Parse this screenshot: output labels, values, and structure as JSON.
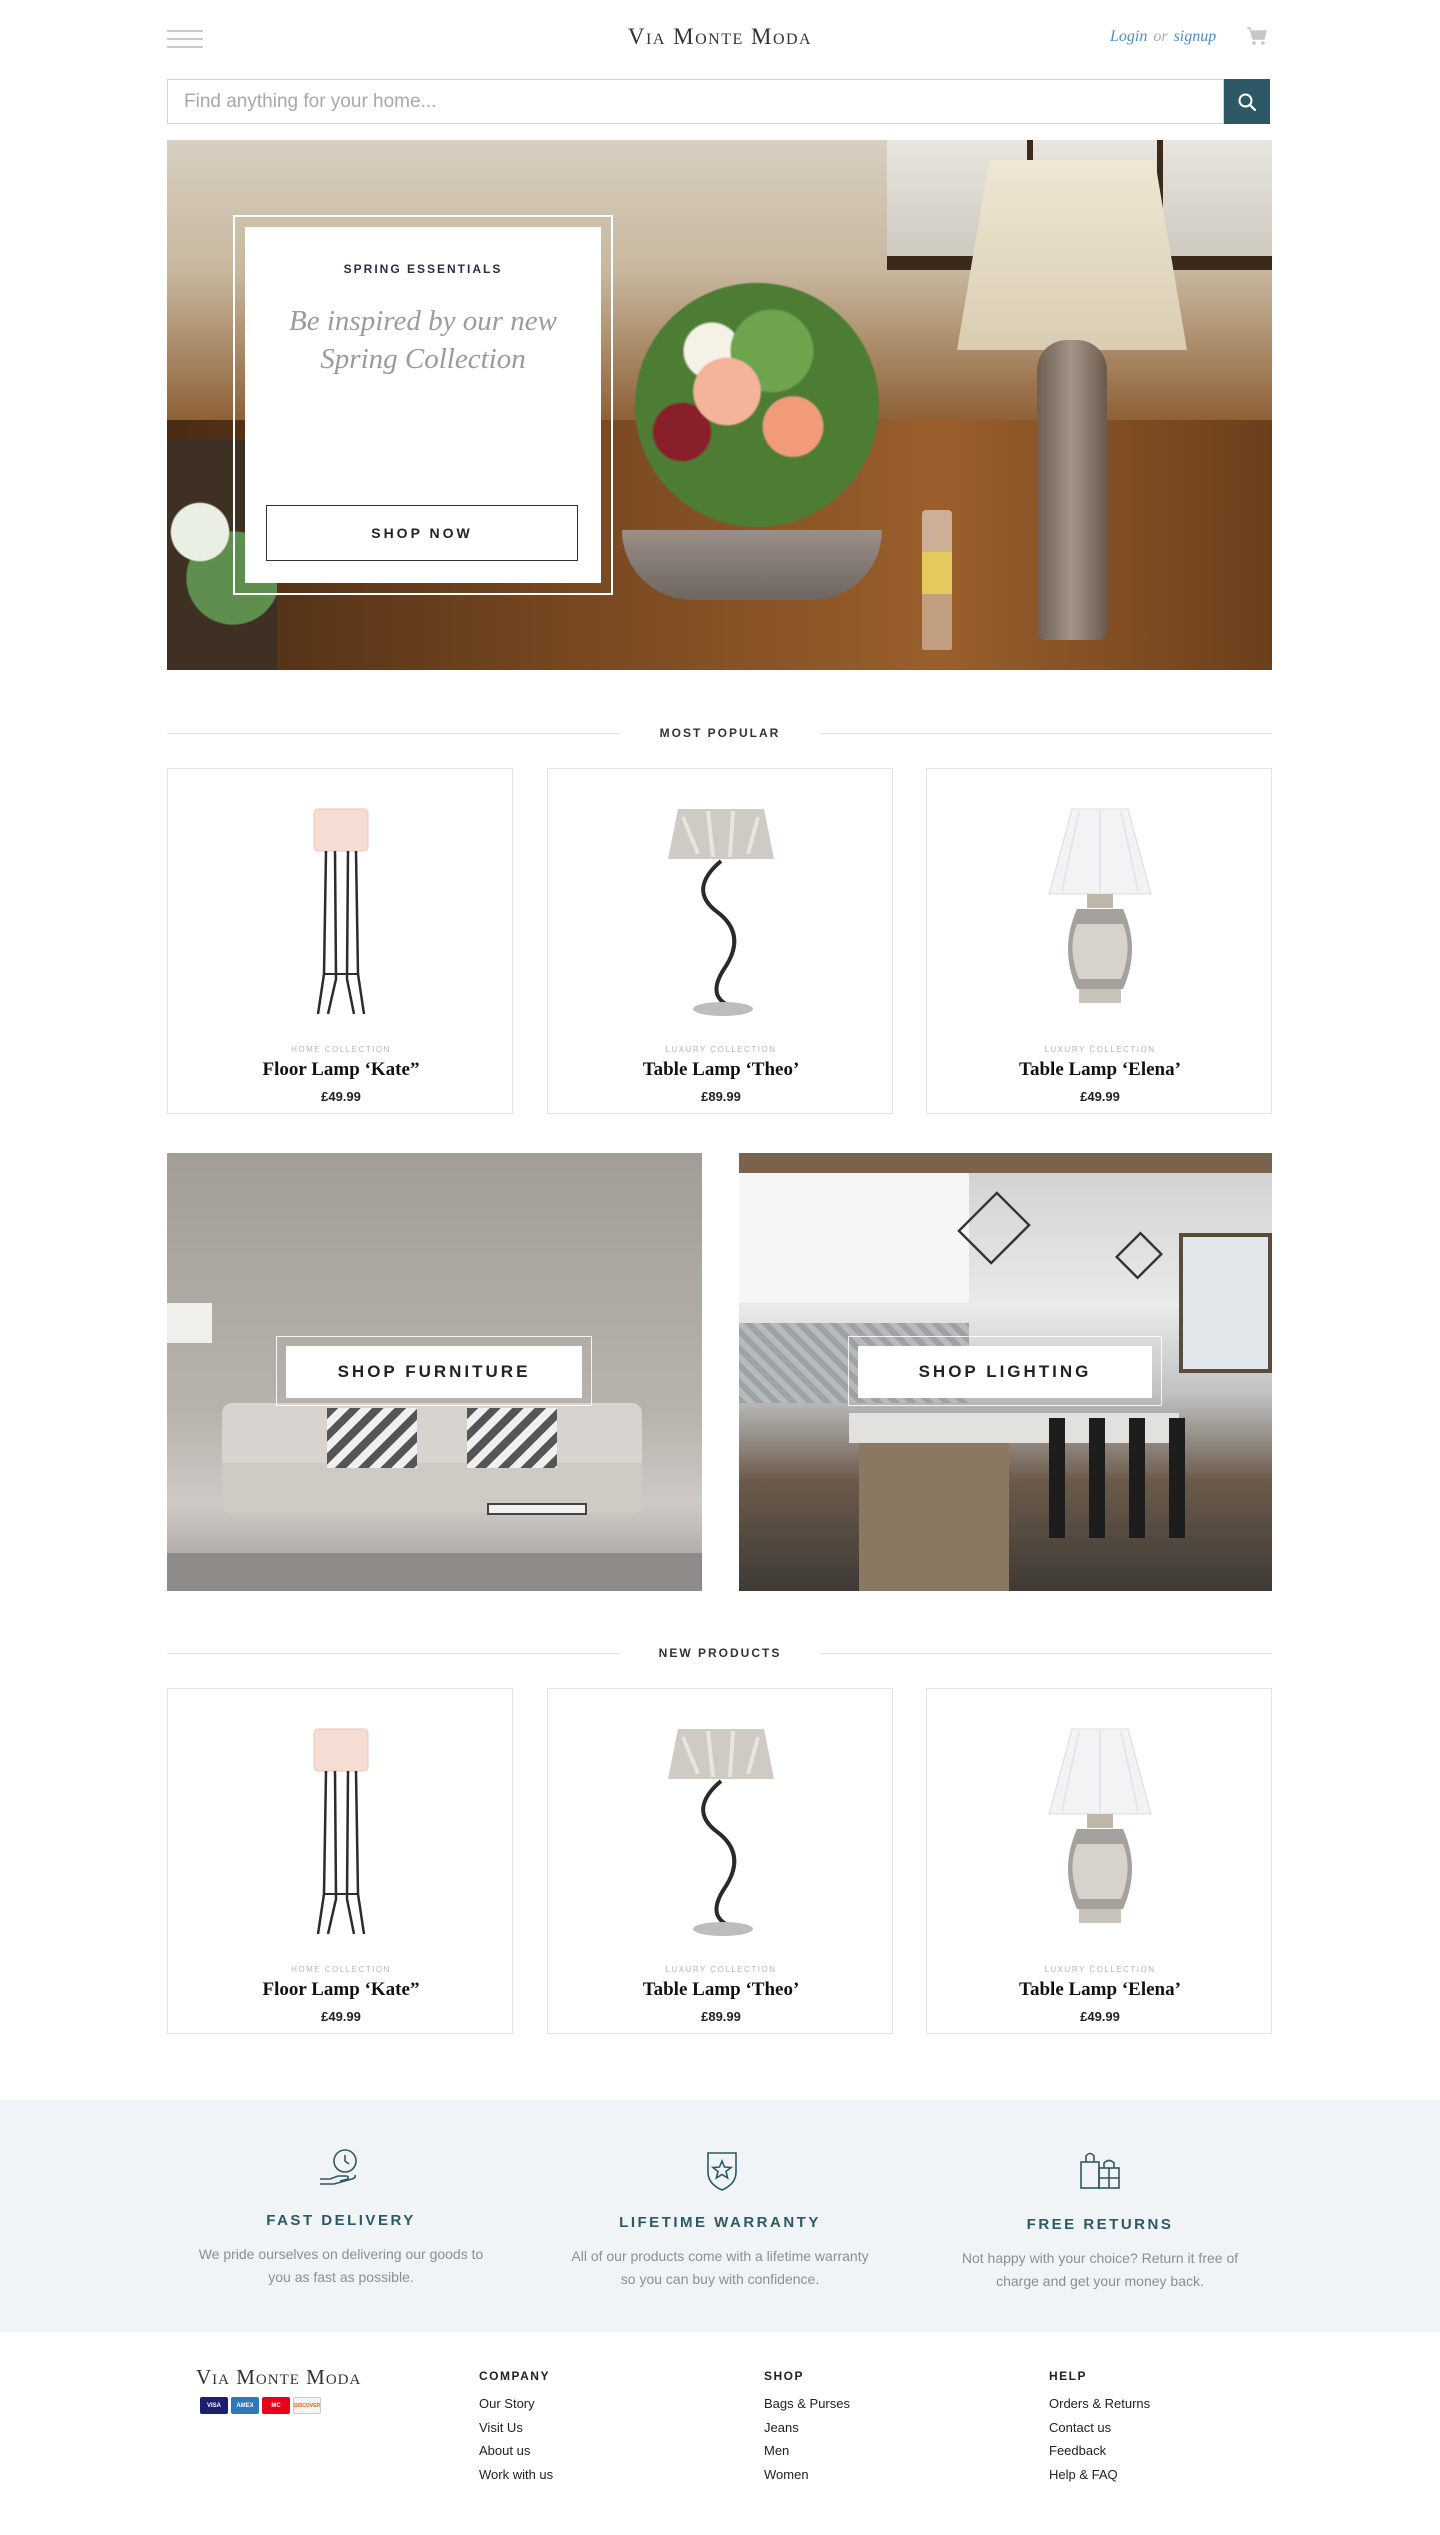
{
  "header": {
    "brand": "Via Monte Moda",
    "login": "Login",
    "or": "or",
    "signup": "signup"
  },
  "search": {
    "placeholder": "Find anything for your home..."
  },
  "hero": {
    "eyebrow": "SPRING ESSENTIALS",
    "headline": "Be inspired by our new Spring Collection",
    "cta": "SHOP NOW"
  },
  "most_popular": {
    "title": "MOST POPULAR",
    "products": [
      {
        "collection": "HOME COLLECTION",
        "name": "Floor Lamp ‘Kate”",
        "price": "£49.99",
        "image": "floor-lamp"
      },
      {
        "collection": "LUXURY COLLECTION",
        "name": "Table Lamp ‘Theo’",
        "price": "£89.99",
        "image": "table-lamp-theo"
      },
      {
        "collection": "LUXURY COLLECTION",
        "name": "Table Lamp ‘Elena’",
        "price": "£49.99",
        "image": "table-lamp-elena"
      }
    ]
  },
  "categories": {
    "furniture": "SHOP FURNITURE",
    "lighting": "SHOP LIGHTING"
  },
  "new_products": {
    "title": "NEW PRODUCTS",
    "products": [
      {
        "collection": "HOME COLLECTION",
        "name": "Floor Lamp ‘Kate”",
        "price": "£49.99",
        "image": "floor-lamp"
      },
      {
        "collection": "LUXURY COLLECTION",
        "name": "Table Lamp ‘Theo’",
        "price": "£89.99",
        "image": "table-lamp-theo"
      },
      {
        "collection": "LUXURY COLLECTION",
        "name": "Table Lamp ‘Elena’",
        "price": "£49.99",
        "image": "table-lamp-elena"
      }
    ]
  },
  "features": [
    {
      "icon": "delivery-clock-icon",
      "title": "FAST DELIVERY",
      "text": "We pride ourselves on delivering our goods to you as fast as possible."
    },
    {
      "icon": "shield-star-icon",
      "title": "LIFETIME WARRANTY",
      "text": "All of our products come with a lifetime warranty so you can buy with confidence."
    },
    {
      "icon": "shopping-bags-icon",
      "title": "FREE RETURNS",
      "text": "Not happy with your choice? Return it free of charge and get your money back."
    }
  ],
  "footer": {
    "brand": "Via Monte Moda",
    "payment_cards": [
      "VISA",
      "AMEX",
      "MC",
      "DISCOVER"
    ],
    "columns": [
      {
        "heading": "COMPANY",
        "links": [
          "Our Story",
          "Visit Us",
          "About us",
          "Work with us"
        ]
      },
      {
        "heading": "SHOP",
        "links": [
          "Bags & Purses",
          "Jeans",
          "Men",
          "Women"
        ]
      },
      {
        "heading": "HELP",
        "links": [
          "Orders & Returns",
          "Contact us",
          "Feedback",
          "Help & FAQ"
        ]
      }
    ]
  },
  "colors": {
    "accent": "#2d5866",
    "link": "#4a90c7",
    "band_bg": "#f1f4f6"
  }
}
